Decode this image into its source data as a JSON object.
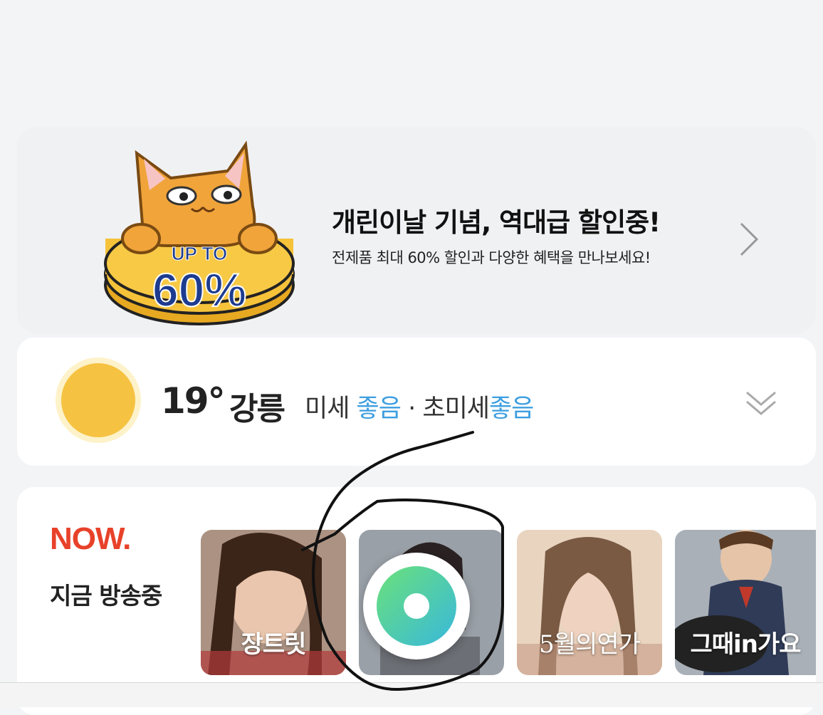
{
  "promo": {
    "badge_top": "UP TO",
    "badge_percent": "60%",
    "title": "개린이날 기념, 역대급 할인중!",
    "subtitle": "전제품 최대 60% 할인과 다양한 혜택을 만나보세요!"
  },
  "weather": {
    "temperature": "19°",
    "city": "강릉",
    "fine_dust_label": "미세",
    "fine_dust_value": "좋음",
    "separator": "·",
    "ultra_fine_dust_label": "초미세",
    "ultra_fine_dust_value": "좋음",
    "icon": "sun-icon"
  },
  "now": {
    "logo": "NOW.",
    "subtitle": "지금 방송중",
    "shows": [
      {
        "label": "장트릿"
      },
      {
        "label": ""
      },
      {
        "label": "5월의연가"
      },
      {
        "label": "그때in가요"
      }
    ]
  },
  "colors": {
    "accent_good": "#3d9ee0",
    "now_red": "#e8412a",
    "badge_blue": "#1d3c8f",
    "badge_yellow": "#f5c23a"
  }
}
